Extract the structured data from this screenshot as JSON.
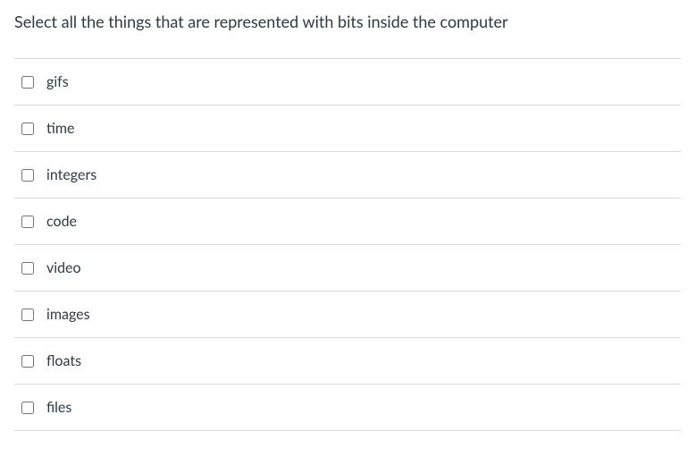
{
  "question": {
    "prompt": "Select all the things that are represented with bits inside the computer",
    "options": [
      {
        "label": "gifs"
      },
      {
        "label": "time"
      },
      {
        "label": "integers"
      },
      {
        "label": "code"
      },
      {
        "label": "video"
      },
      {
        "label": "images"
      },
      {
        "label": "floats"
      },
      {
        "label": "files"
      }
    ]
  }
}
